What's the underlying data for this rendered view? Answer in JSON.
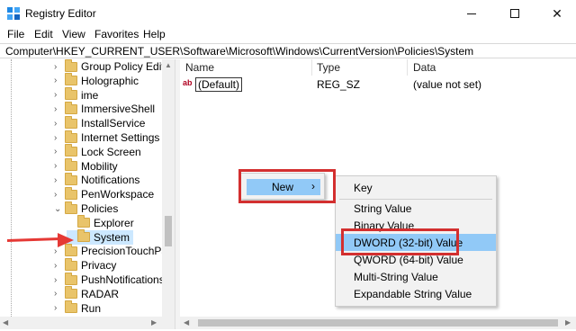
{
  "window": {
    "title": "Registry Editor",
    "min_glyph": "",
    "close_glyph": "✕"
  },
  "menu": [
    "File",
    "Edit",
    "View",
    "Favorites",
    "Help"
  ],
  "address": "Computer\\HKEY_CURRENT_USER\\Software\\Microsoft\\Windows\\CurrentVersion\\Policies\\System",
  "tree": {
    "items": [
      {
        "label": "Group Policy Editor",
        "indent": 0,
        "expanded": false
      },
      {
        "label": "Holographic",
        "indent": 0,
        "expanded": false
      },
      {
        "label": "ime",
        "indent": 0,
        "expanded": false
      },
      {
        "label": "ImmersiveShell",
        "indent": 0,
        "expanded": false
      },
      {
        "label": "InstallService",
        "indent": 0,
        "expanded": false
      },
      {
        "label": "Internet Settings",
        "indent": 0,
        "expanded": false
      },
      {
        "label": "Lock Screen",
        "indent": 0,
        "expanded": false
      },
      {
        "label": "Mobility",
        "indent": 0,
        "expanded": false
      },
      {
        "label": "Notifications",
        "indent": 0,
        "expanded": false
      },
      {
        "label": "PenWorkspace",
        "indent": 0,
        "expanded": false
      },
      {
        "label": "Policies",
        "indent": 0,
        "expanded": true
      },
      {
        "label": "Explorer",
        "indent": 1,
        "expanded": false
      },
      {
        "label": "System",
        "indent": 1,
        "expanded": false,
        "selected": true
      },
      {
        "label": "PrecisionTouchPad",
        "indent": 0,
        "expanded": false
      },
      {
        "label": "Privacy",
        "indent": 0,
        "expanded": false
      },
      {
        "label": "PushNotifications",
        "indent": 0,
        "expanded": false
      },
      {
        "label": "RADAR",
        "indent": 0,
        "expanded": false
      },
      {
        "label": "Run",
        "indent": 0,
        "expanded": false
      }
    ]
  },
  "values": {
    "columns": {
      "name": "Name",
      "type": "Type",
      "data": "Data"
    },
    "rows": [
      {
        "icon": "ab",
        "name": "(Default)",
        "type": "REG_SZ",
        "data": "(value not set)"
      }
    ]
  },
  "context_menu": {
    "new_label": "New",
    "new_arrow": "›"
  },
  "submenu": {
    "items": [
      "Key",
      "String Value",
      "Binary Value",
      "DWORD (32-bit) Value",
      "QWORD (64-bit) Value",
      "Multi-String Value",
      "Expandable String Value"
    ],
    "highlighted": "DWORD (32-bit) Value"
  },
  "colors": {
    "highlight": "#91c9f7",
    "annotation_red": "#d32f2f",
    "folder": "#e9c46a"
  }
}
